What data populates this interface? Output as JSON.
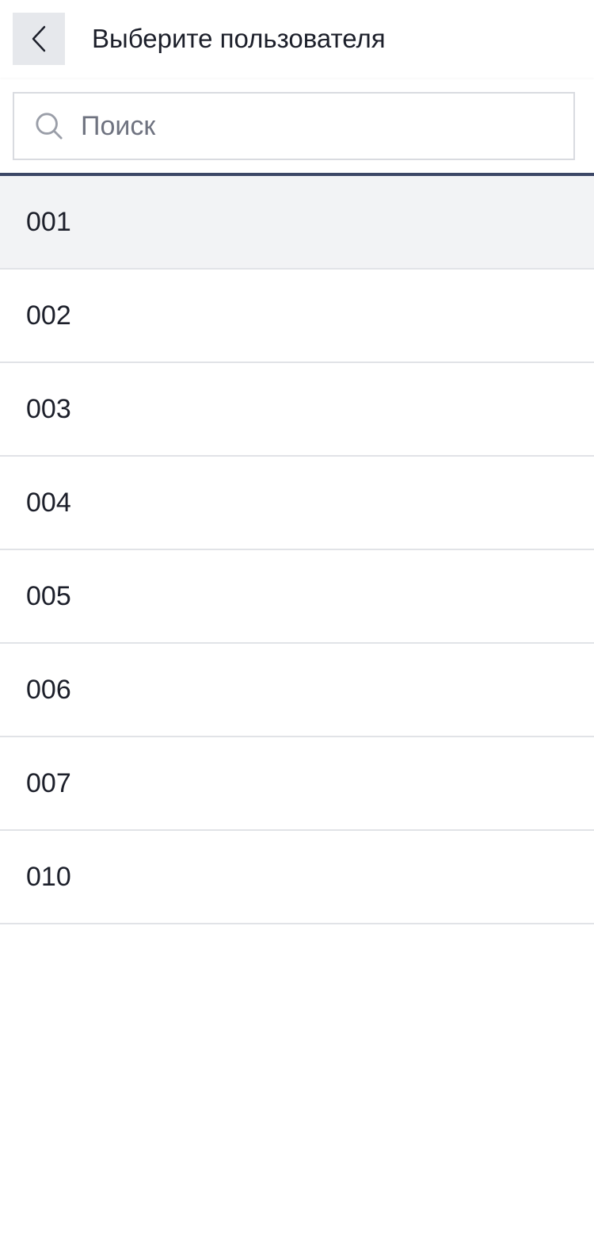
{
  "header": {
    "title": "Выберите пользователя",
    "back_icon": "chevron-left-icon"
  },
  "search": {
    "placeholder": "Поиск",
    "value": "",
    "icon": "search-icon"
  },
  "colors": {
    "accent_line": "#3c4766",
    "selected_row_bg": "#f2f3f5",
    "back_button_bg": "#e6e8ec",
    "text": "#1c1f2a",
    "placeholder": "#6f7380"
  },
  "users": [
    {
      "label": "001",
      "selected": true
    },
    {
      "label": "002",
      "selected": false
    },
    {
      "label": "003",
      "selected": false
    },
    {
      "label": "004",
      "selected": false
    },
    {
      "label": "005",
      "selected": false
    },
    {
      "label": "006",
      "selected": false
    },
    {
      "label": "007",
      "selected": false
    },
    {
      "label": "010",
      "selected": false
    }
  ]
}
